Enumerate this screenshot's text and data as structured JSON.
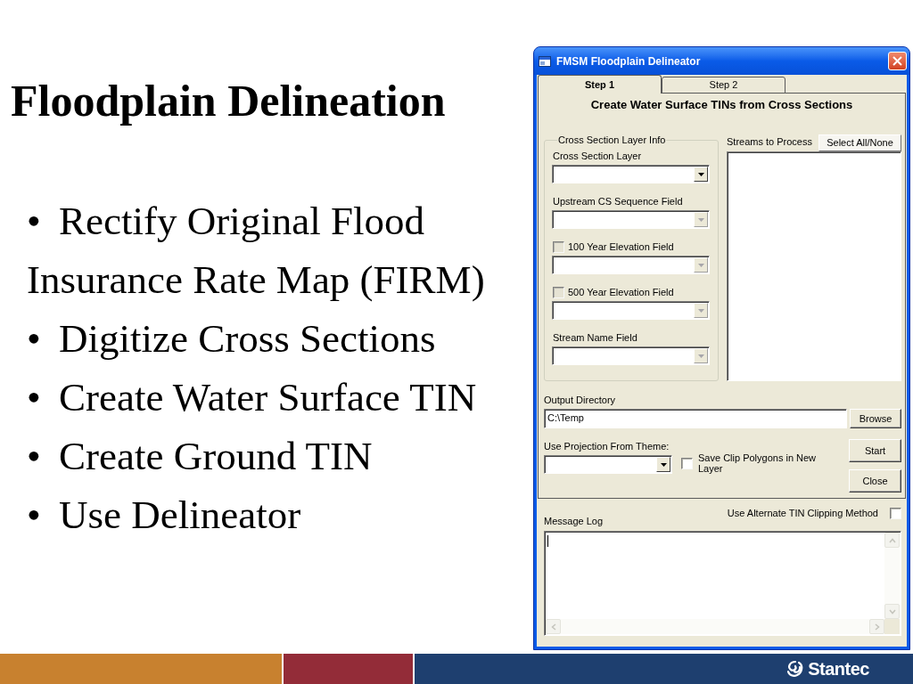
{
  "slide": {
    "title": "Floodplain Delineation",
    "bullets": [
      {
        "marker": "•",
        "text": "Rectify Original Flood Insurance Rate Map (FIRM)"
      },
      {
        "marker": "•",
        "text": "Digitize Cross Sections"
      },
      {
        "marker": "•",
        "text": "Create Water Surface TIN"
      },
      {
        "marker": "•",
        "text": "Create Ground TIN"
      },
      {
        "marker": "•",
        "text": "Use Delineator"
      }
    ]
  },
  "dialog": {
    "title": "FMSM Floodplain Delineator",
    "tabs": [
      {
        "label": "Step 1",
        "selected": true
      },
      {
        "label": "Step 2",
        "selected": false
      }
    ],
    "heading": "Create Water Surface TINs from Cross Sections",
    "layer_group": {
      "legend": "Cross Section Layer Info",
      "fields": [
        {
          "kind": "plain",
          "label": "Cross Section Layer",
          "disabled": false
        },
        {
          "kind": "plain",
          "label": "Upstream CS Sequence Field",
          "disabled": true
        },
        {
          "kind": "checkbox",
          "label": "100 Year Elevation Field",
          "checked": false,
          "disabled": true
        },
        {
          "kind": "checkbox",
          "label": "500 Year Elevation Field",
          "checked": false,
          "disabled": true
        },
        {
          "kind": "plain",
          "label": "Stream Name Field",
          "disabled": true
        }
      ]
    },
    "streams": {
      "label": "Streams to Process",
      "button": "Select All/None"
    },
    "output_directory": {
      "label": "Output Directory",
      "value": "C:\\Temp",
      "button": "Browse"
    },
    "projection": {
      "label": "Use Projection From Theme:",
      "disabled": false
    },
    "save_clip": {
      "label": "Save Clip Polygons in New Layer",
      "checked": false
    },
    "buttons": [
      "Start",
      "Close"
    ],
    "alternate_clipping": {
      "label": "Use Alternate TIN Clipping Method",
      "checked": false
    },
    "message_log": {
      "label": "Message Log"
    }
  },
  "footer": {
    "logo_text": "Stantec"
  }
}
